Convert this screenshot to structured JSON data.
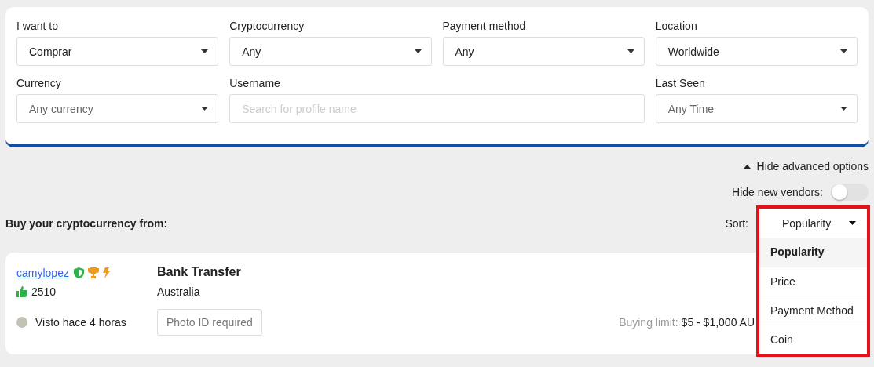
{
  "filters": [
    [
      {
        "kind": "select",
        "label": "I want to",
        "value": "Comprar"
      },
      {
        "kind": "select",
        "label": "Cryptocurrency",
        "value": "Any"
      },
      {
        "kind": "select",
        "label": "Payment method",
        "value": "Any"
      },
      {
        "kind": "select",
        "label": "Location",
        "value": "Worldwide"
      }
    ],
    [
      {
        "kind": "select",
        "label": "Currency",
        "placeholder": "Any currency"
      },
      {
        "kind": "text",
        "label": "Username",
        "placeholder": "Search for profile name"
      },
      {
        "kind": "select",
        "label": "Last Seen",
        "placeholder": "Any Time"
      }
    ]
  ],
  "advanced": {
    "label": "Hide advanced options",
    "expanded": true
  },
  "hide_new_vendors": {
    "label": "Hide new vendors:",
    "on": false
  },
  "heading": "Buy your cryptocurrency from:",
  "sort": {
    "label": "Sort:",
    "value": "Popularity",
    "open": true,
    "options": [
      {
        "label": "Popularity",
        "selected": true
      },
      {
        "label": "Price",
        "selected": false
      },
      {
        "label": "Payment Method",
        "selected": false
      },
      {
        "label": "Coin",
        "selected": false
      }
    ]
  },
  "listing": {
    "username": "camylopez",
    "rating": "2510",
    "method": "Bank Transfer",
    "location": "Australia",
    "last_seen": "Visto hace 4 horas",
    "online": false,
    "requirement": "Photo ID required",
    "limit_label": "Buying limit:",
    "limit_value": "$5 - $1,000 AU"
  }
}
